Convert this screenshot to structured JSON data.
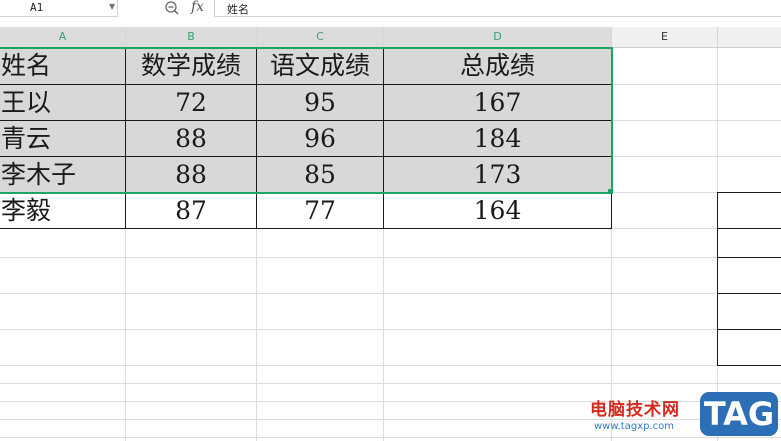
{
  "formula_bar": {
    "name_box": "A1",
    "fx_label": "fx",
    "formula_value": "姓名"
  },
  "columns": [
    "A",
    "B",
    "C",
    "D",
    "E"
  ],
  "table": {
    "headers": [
      "姓名",
      "数学成绩",
      "语文成绩",
      "总成绩"
    ],
    "rows": [
      [
        "王以",
        "72",
        "95",
        "167"
      ],
      [
        "青云",
        "88",
        "96",
        "184"
      ],
      [
        "李木子",
        "88",
        "85",
        "173"
      ],
      [
        "李毅",
        "87",
        "77",
        "164"
      ]
    ]
  },
  "selection": {
    "range": "A1:D4",
    "color": "#21a366"
  },
  "watermark": {
    "site_name": "电脑技术网",
    "url": "www.tagxp.com",
    "logo": "TAG"
  }
}
